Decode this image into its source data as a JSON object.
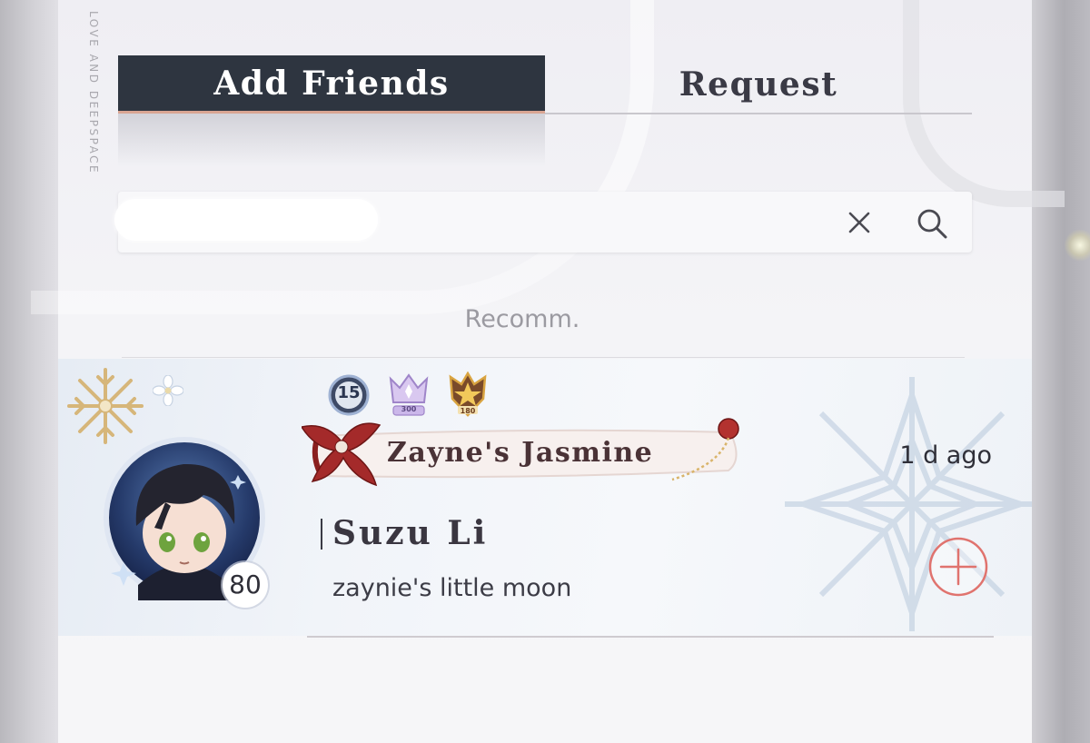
{
  "brand": {
    "vertical_text": "LOVE AND DEEPSPACE"
  },
  "tabs": [
    {
      "label": "Add Friends",
      "active": true
    },
    {
      "label": "Request",
      "active": false
    }
  ],
  "search": {
    "value": "redacted",
    "value_hidden": true,
    "icons": [
      "close-icon",
      "search-icon"
    ]
  },
  "section": {
    "label": "Recomm."
  },
  "friend_card": {
    "medals": [
      {
        "icon": "level-medal-icon",
        "label": "15"
      },
      {
        "icon": "crown-medal-icon",
        "label": "300"
      },
      {
        "icon": "star-medal-icon",
        "label": "180"
      }
    ],
    "title": "Zayne's Jasmine",
    "time_ago": "1 d ago",
    "name": "Suzu Li",
    "signature": "zaynie's little moon",
    "level": "80",
    "add_icon": "plus-circle-icon"
  },
  "colors": {
    "tab_active_bg": "#2e3540",
    "tab_underline": "#d9a592",
    "add_button": "#e0736e",
    "title_ribbon": "#a42a2a"
  }
}
